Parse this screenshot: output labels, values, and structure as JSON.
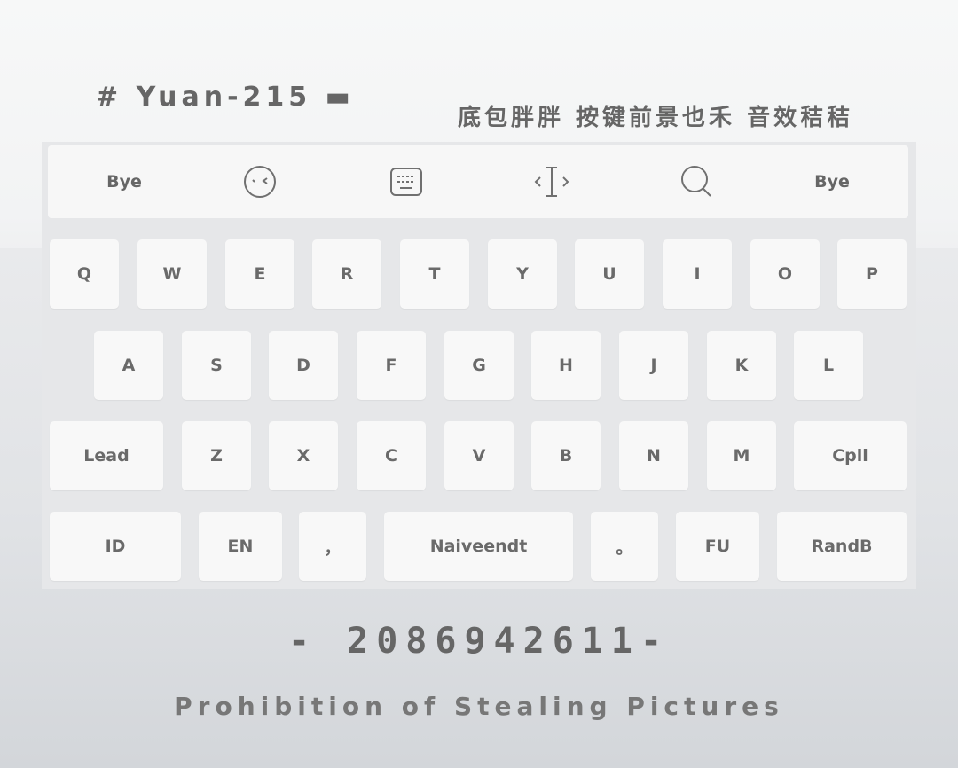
{
  "header": {
    "title": "# Yuan-215 ▬",
    "subtitle": "底包胖胖 按键前景也禾 音效秸秸"
  },
  "toolbar": {
    "left_label": "Bye",
    "right_label": "Bye",
    "icons": [
      "emoji-face-icon",
      "keyboard-icon",
      "text-cursor-icon",
      "search-icon"
    ]
  },
  "keyboard": {
    "row1": [
      "Q",
      "W",
      "E",
      "R",
      "T",
      "Y",
      "U",
      "I",
      "O",
      "P"
    ],
    "row2": [
      "A",
      "S",
      "D",
      "F",
      "G",
      "H",
      "J",
      "K",
      "L"
    ],
    "row3": [
      "Lead",
      "Z",
      "X",
      "C",
      "V",
      "B",
      "N",
      "M",
      "Cpll"
    ],
    "row4": [
      "ID",
      "EN",
      "，",
      "Naiveendt",
      "。",
      "FU",
      "RandB"
    ]
  },
  "footer": {
    "serial": "- 2086942611-",
    "notice": "Prohibition of Stealing Pictures"
  }
}
